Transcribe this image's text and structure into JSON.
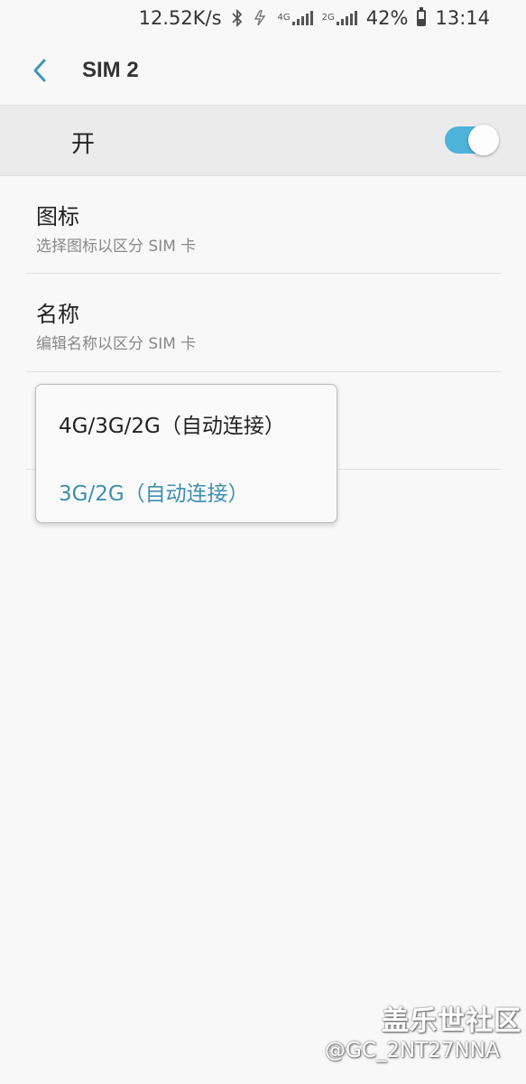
{
  "status_bar": {
    "net_speed": "12.52K/s",
    "signal1_type": "4G",
    "signal2_type": "2G",
    "battery_percent": "42%",
    "battery_level": 0.42,
    "time": "13:14",
    "icons": [
      "bluetooth-icon",
      "data-saver-icon",
      "signal-icon",
      "battery-icon"
    ]
  },
  "header": {
    "title": "SIM 2",
    "back_icon": "chevron-left-icon"
  },
  "master_switch": {
    "label": "开",
    "state": "on",
    "accent_color": "#4fb3d9"
  },
  "settings": [
    {
      "title": "图标",
      "subtitle": "选择图标以区分 SIM 卡"
    },
    {
      "title": "名称",
      "subtitle": "编辑名称以区分 SIM 卡"
    }
  ],
  "network_mode_popup": {
    "options": [
      {
        "label": "4G/3G/2G（自动连接）",
        "selected": false
      },
      {
        "label": "3G/2G（自动连接）",
        "selected": true
      }
    ],
    "selected_color": "#3d8fb0"
  },
  "watermark": {
    "title": "盖乐世社区",
    "user": "@GC_2NT27NNA"
  }
}
